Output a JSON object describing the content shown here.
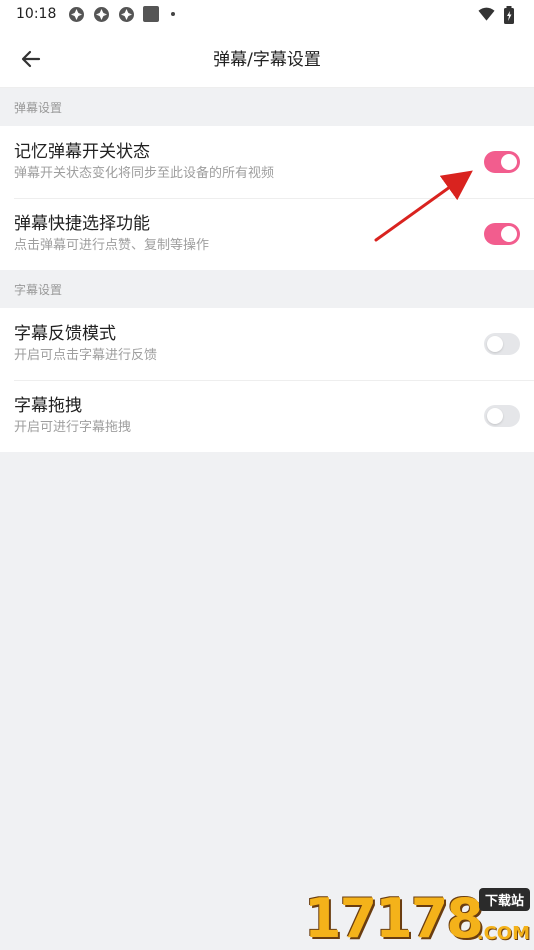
{
  "status_bar": {
    "time": "10:18",
    "left_icons": [
      "notification-icon",
      "notification-icon",
      "notification-icon",
      "square-notification-icon",
      "dot-icon"
    ],
    "right_icons": [
      "wifi-icon",
      "battery-icon"
    ]
  },
  "app_bar": {
    "title": "弹幕/字幕设置",
    "back_icon": "arrow-left-icon"
  },
  "sections": [
    {
      "header": "弹幕设置",
      "items": [
        {
          "title": "记忆弹幕开关状态",
          "subtitle": "弹幕开关状态变化将同步至此设备的所有视频",
          "enabled": true
        },
        {
          "title": "弹幕快捷选择功能",
          "subtitle": "点击弹幕可进行点赞、复制等操作",
          "enabled": true
        }
      ]
    },
    {
      "header": "字幕设置",
      "items": [
        {
          "title": "字幕反馈模式",
          "subtitle": "开启可点击字幕进行反馈",
          "enabled": false
        },
        {
          "title": "字幕拖拽",
          "subtitle": "开启可进行字幕拖拽",
          "enabled": false
        }
      ]
    }
  ],
  "watermark": {
    "digits": "17178",
    "badge": "下载站",
    "domain": ".COM"
  },
  "colors": {
    "accent": "#f25d8e",
    "toggle_off": "#e5e6e9",
    "annotation_arrow": "#d9231f",
    "background": "#f0f1f3"
  }
}
